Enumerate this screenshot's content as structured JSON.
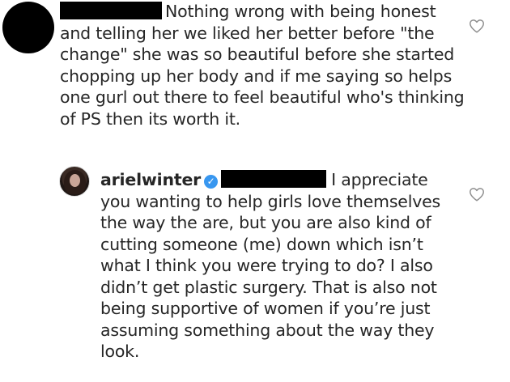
{
  "comments": [
    {
      "username": "",
      "text": "Nothing wrong with being honest and telling her we liked her better before \"the change\" she was so beautiful before she started chopping up her body and if me saying so helps one gurl out there to feel beautiful who's thinking of PS then its worth it.",
      "redacted_mention": true,
      "like_icon": "heart-outline-icon"
    },
    {
      "username": "arielwinter",
      "verified": true,
      "verified_icon": "verified-badge-icon",
      "verified_glyph": "✓",
      "text": "I appreciate you wanting to help girls love themselves the way the are, but you are also kind of cutting someone (me) down which isn’t what I think you were trying to do? I also didn’t get plastic surgery. That is also not being supportive of women if you’re just assuming something about the way they look.",
      "redacted_mention": true,
      "like_icon": "heart-outline-icon"
    }
  ],
  "colors": {
    "text": "#262626",
    "verified_badge": "#3897f0",
    "redaction": "#000000",
    "heart_outline": "#8e8e8e",
    "background": "#ffffff"
  }
}
